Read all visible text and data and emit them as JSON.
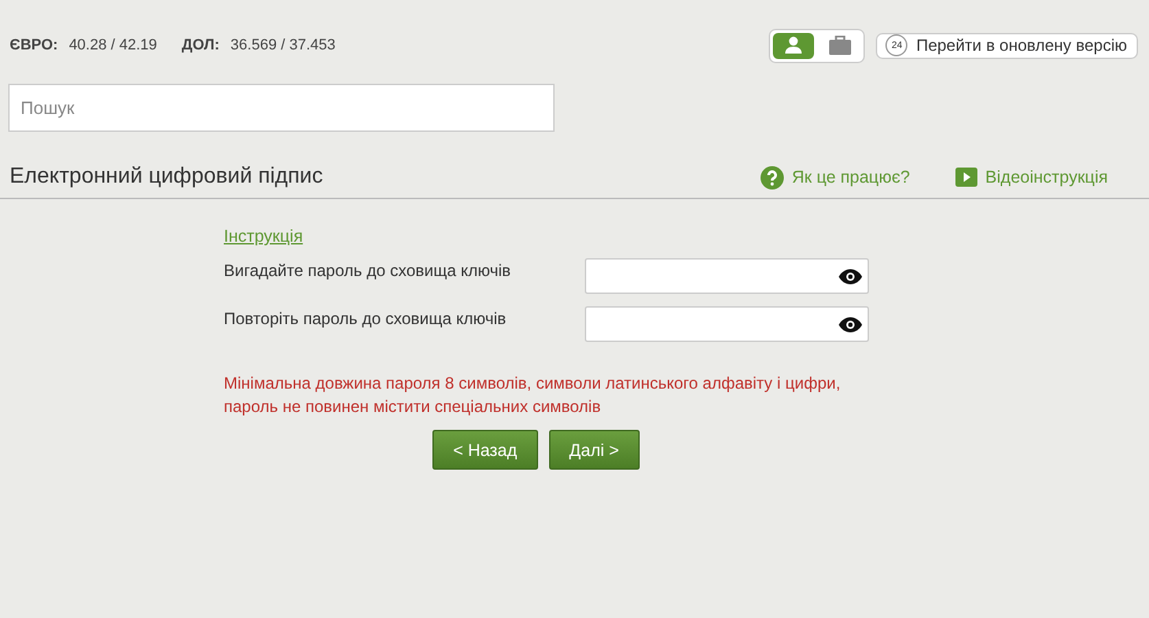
{
  "rates": [
    {
      "currency": "ЄВРО:",
      "value": "40.28 / 42.19"
    },
    {
      "currency": "ДОЛ:",
      "value": "36.569 / 37.453"
    }
  ],
  "view_toggle": [
    {
      "kind": "person",
      "selected": true
    },
    {
      "kind": "briefcase",
      "selected": false
    }
  ],
  "new_version": {
    "badge": "24",
    "label": "Перейти в оновлену версію"
  },
  "search": {
    "placeholder": "Пошук"
  },
  "section": {
    "title": "Електронний цифровий підпис",
    "links": [
      {
        "kind": "help",
        "label": "Як це працює?"
      },
      {
        "kind": "video",
        "label": "Відеоінструкція"
      }
    ]
  },
  "form": {
    "instruction_link": "Інструкція",
    "fields": [
      {
        "label": "Вигадайте пароль до сховища ключів"
      },
      {
        "label": "Повторіть пароль до сховища ключів"
      }
    ],
    "warning": "Мінімальна довжина пароля 8 символів, символи латинського алфавіту і цифри, пароль не повинен містити спеціальних символів",
    "buttons": [
      "< Назад",
      "Далі >"
    ]
  }
}
